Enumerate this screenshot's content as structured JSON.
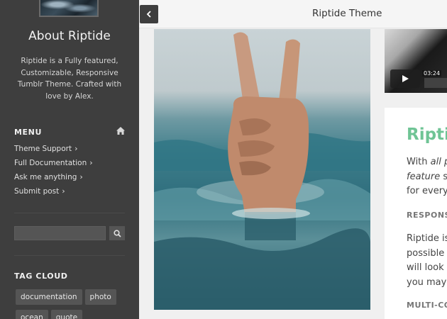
{
  "sidebar": {
    "about_title": "About Riptide",
    "about_text": "Riptide is a Fully featured, Customizable, Responsive Tumblr Theme. Crafted with love by Alex.",
    "menu_heading": "MENU",
    "menu_items": [
      {
        "label": "Theme Support"
      },
      {
        "label": "Full Documentation"
      },
      {
        "label": "Ask me anything"
      },
      {
        "label": "Submit post"
      }
    ],
    "search_placeholder": "",
    "tag_cloud_heading": "TAG CLOUD",
    "tags": [
      "documentation",
      "photo",
      "ocean",
      "quote"
    ]
  },
  "header": {
    "site_title": "Riptide Theme"
  },
  "video": {
    "duration": "03:24"
  },
  "post": {
    "title": "Riptid",
    "intro_lines": [
      "With all p",
      "feature su",
      "for everyo"
    ],
    "sub_heading_1": "RESPONSI",
    "para_lines": [
      "Riptide is",
      "possible d",
      "will look e",
      "you may"
    ],
    "sub_heading_2": "MULTI-CO"
  },
  "colors": {
    "sidebar_bg": "#3e3e3e",
    "accent_green": "#6fc495"
  }
}
